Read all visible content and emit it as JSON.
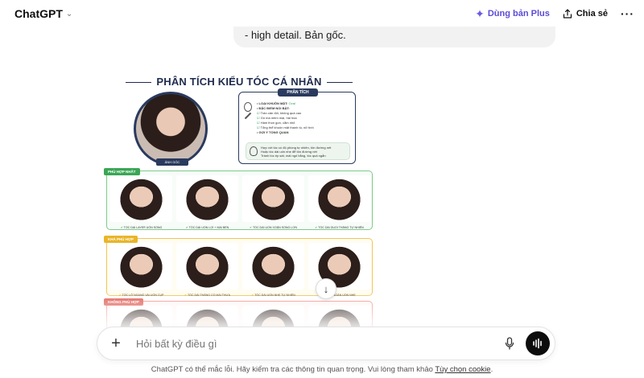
{
  "header": {
    "app_title": "ChatGPT",
    "upgrade_label": "Dùng bản Plus",
    "share_label": "Chia sẻ",
    "more_label": "···"
  },
  "conversation": {
    "user_message": "- high detail. Bản gốc."
  },
  "generated_image": {
    "title": "PHÂN TÍCH KIỂU TÓC CÁ NHÂN",
    "original_label": "ẢNH GỐC",
    "analysis": {
      "heading": "PHÂN TÍCH",
      "face_shape_label": "• LOẠI KHUÔN MẶT:",
      "face_shape_value": "Oval",
      "features_label": "• ĐẶC ĐIỂM NỔI BẬT:",
      "features": [
        "Trán cân đối, không quá cao",
        "Gò má mềm mại, hài hòa",
        "Hàm thon gọn, cằm nhỏ",
        "Tổng thể khuôn mặt thanh tú, nữ tính"
      ],
      "overview_label": "• GỢI Ý TỔNG QUAN",
      "overview": [
        "Hợp với tóc có độ phồng tự nhiên, tôn đường nét",
        "Hoặc tóc dài uốn nhẹ để tôn đường nét",
        "Tránh tóc ép sát, mái ngố bằng, tóc quá ngắn"
      ]
    },
    "sections": [
      {
        "tag": "PHÙ HỢP NHẤT",
        "captions": [
          "TÓC DÀI LAYER UỐN SÓNG",
          "TÓC DÀI UỐN LỢI + MÁI BÉN",
          "TÓC DÀI UỐN XOĂN SÓNG LƠN",
          "TÓC DÀI DUỖI THẲNG TỰ NHIÊN"
        ]
      },
      {
        "tag": "KHÁ PHÙ HỢP",
        "captions": [
          "TÓC LỠ NGANG VAI UỐN CỤP",
          "TÓC DÀI THẲNG CÓ MÁI THƯA",
          "TÓC DÀI UỐN NHẸ TỰ NHIÊN",
          "TÓC NGẮN UỐN NHẸ"
        ]
      },
      {
        "tag": "KHÔNG PHÙ HỢP",
        "captions": [
          "",
          "",
          "",
          ""
        ]
      }
    ]
  },
  "composer": {
    "placeholder": "Hỏi bất kỳ điều gì"
  },
  "footer": {
    "note": "ChatGPT có thể mắc lỗi. Hãy kiểm tra các thông tin quan trọng. Vui lòng tham khảo ",
    "link_label": "Tùy chọn cookie",
    "note_end": "."
  },
  "colors": {
    "accent": "#5b4bd6",
    "navy": "#1f2a4d",
    "green": "#3aa655",
    "yellow": "#e9b529",
    "red": "#e0584f"
  }
}
